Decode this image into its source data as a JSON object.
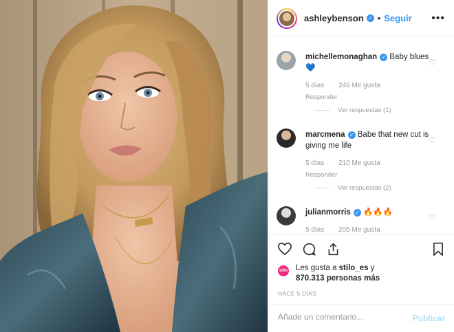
{
  "header": {
    "username": "ashleybenson",
    "separator": "•",
    "follow_label": "Seguir",
    "more_icon": "more-options-icon"
  },
  "comments": [
    {
      "username": "michellemonaghan",
      "text": "Baby blues 💙",
      "time": "5 días",
      "likes": "246 Me gusta",
      "reply": "Responder",
      "view_replies": "Ver respuestas (1)"
    },
    {
      "username": "marcmena",
      "text": "Babe that new cut is giving me life",
      "time": "5 días",
      "likes": "210 Me gusta",
      "reply": "Responder",
      "view_replies": "Ver respuestas (2)"
    },
    {
      "username": "julianmorris",
      "text": "🔥🔥🔥",
      "time": "5 días",
      "likes": "205 Me gusta"
    }
  ],
  "likes": {
    "avatar_text": "stilo",
    "prefix": "Les gusta a ",
    "user": "stilo_es",
    "conjunction": " y",
    "count": "870.313 personas más"
  },
  "timestamp": "HACE 5 DÍAS",
  "comment_input": {
    "placeholder": "Añade un comentario...",
    "publish_label": "Publicar"
  },
  "colors": {
    "accent": "#3897f0",
    "publish_disabled": "#b2dffc",
    "secondary_text": "#999999"
  }
}
